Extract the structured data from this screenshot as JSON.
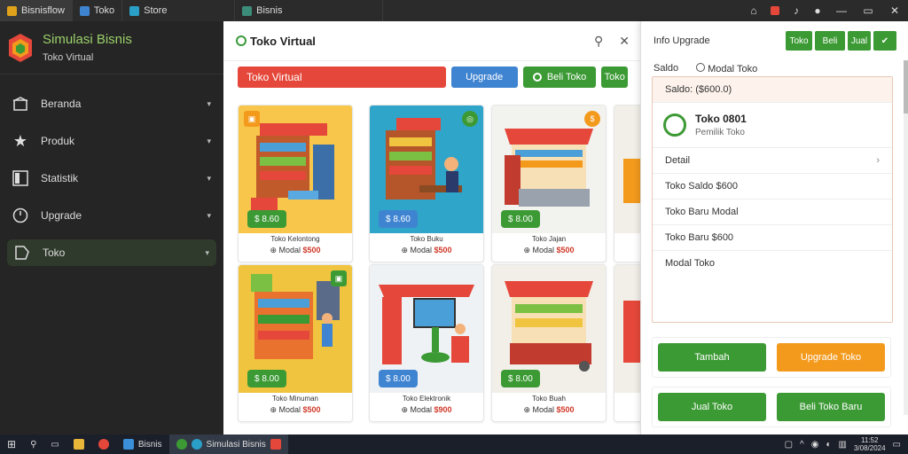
{
  "titlebar": {
    "tabs": [
      {
        "label": "Bisnisflow",
        "color": "#e0a21b"
      },
      {
        "label": "Toko",
        "color": "#3f84d1"
      },
      {
        "label": "Store",
        "color": "#2aa0c8"
      },
      {
        "label": "Bisnis",
        "color": "#3c8c7a"
      }
    ]
  },
  "sidebar": {
    "title": "Simulasi Bisnis",
    "subtitle": "Toko Virtual",
    "items": [
      {
        "label": "Beranda",
        "icon": "home-icon"
      },
      {
        "label": "Produk",
        "icon": "star-icon"
      },
      {
        "label": "Statistik",
        "icon": "stats-icon"
      },
      {
        "label": "Upgrade",
        "icon": "upgrade-icon"
      },
      {
        "label": "Toko",
        "icon": "store-icon",
        "active": true
      }
    ]
  },
  "main": {
    "title": "Toko Virtual",
    "toolbar": {
      "search_label": "Toko Virtual",
      "upgrade_label": "Upgrade",
      "buy_label": "Beli Toko",
      "more_label": "Toko"
    },
    "cards": [
      {
        "price": "$ 8.60",
        "name": "Toko Kelontong",
        "cost": "$500",
        "price_color": "#3c9a35",
        "bg": "#f7c64a"
      },
      {
        "price": "$ 8.60",
        "name": "Toko Buku",
        "cost": "$500",
        "price_color": "#3f84d1",
        "bg": "#2ea5c9"
      },
      {
        "price": "$ 8.00",
        "name": "Toko Jajan",
        "cost": "$500",
        "price_color": "#3c9a35",
        "bg": "#f2f2ef"
      },
      {
        "price": "$ 8.00",
        "name": "Toko Minuman",
        "cost": "$500",
        "price_color": "#3c9a35",
        "bg": "#f0c43e"
      },
      {
        "price": "$ 8.00",
        "name": "Toko Elektronik",
        "cost": "$900",
        "price_color": "#3f84d1",
        "bg": "#eef2f5"
      },
      {
        "price": "$ 8.00",
        "name": "Toko Buah",
        "cost": "$500",
        "price_color": "#3c9a35",
        "bg": "#f2efe9"
      }
    ]
  },
  "right": {
    "title": "Info Upgrade",
    "buttons": [
      "Toko",
      "Beli",
      "Jual"
    ],
    "tabs": {
      "left": "Saldo",
      "right": "Modal Toko"
    },
    "summary": "Saldo: ($600.0)",
    "account": {
      "name": "Toko 0801",
      "status": "Pemilik Toko"
    },
    "rows": [
      "Detail",
      "Toko Saldo $600",
      "Toko Baru Modal",
      "Toko Baru $600",
      "Modal Toko"
    ],
    "actions": [
      {
        "left": "Tambah",
        "right": "Upgrade Toko",
        "left_color": "#3c9a35",
        "right_color": "#f39a1d"
      },
      {
        "left": "Jual Toko",
        "right": "Beli Toko Baru",
        "left_color": "#3c9a35",
        "right_color": "#3c9a35"
      }
    ]
  },
  "taskbar": {
    "items": [
      {
        "label": "Bisnis",
        "color": "#3a8fd8"
      },
      {
        "label": "Simulasi Bisnis",
        "color": "#3c9a35",
        "active": true
      }
    ],
    "time": "11:52",
    "date": "3/08/2024"
  }
}
